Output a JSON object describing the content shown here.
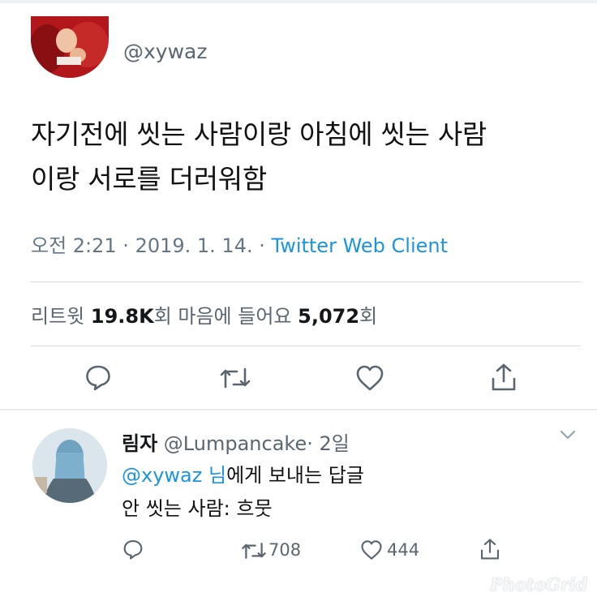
{
  "tweet": {
    "handle": "@xywaz",
    "text_line1": "자기전에 씻는 사람이랑 아침에 씻는 사람",
    "text_line2": "이랑 서로를 더러워함",
    "time": "오전 2:21 · 2019. 1. 14. · ",
    "client": "Twitter Web Client",
    "retweet_label": "리트윗 ",
    "retweet_count": "19.8K",
    "retweet_suffix": "회  마음에 들어요 ",
    "like_count": "5,072",
    "like_suffix": "회"
  },
  "actions": {
    "reply_icon": "speech-bubble-icon",
    "retweet_icon": "retweet-arrows-icon",
    "like_icon": "heart-icon",
    "share_icon": "share-upload-icon"
  },
  "reply": {
    "name": "림자",
    "handle": " @Lumpancake",
    "time": "· 2일",
    "mention": "@xywaz 님",
    "replying_suffix": "에게 보내는 답글",
    "text": "안 씻는 사람: 흐뭇",
    "retweet_count": "708",
    "like_count": "444"
  },
  "watermark": "PhotoGrid",
  "colors": {
    "link": "#1b95e0",
    "muted": "#5b6670",
    "text": "#14171a"
  }
}
